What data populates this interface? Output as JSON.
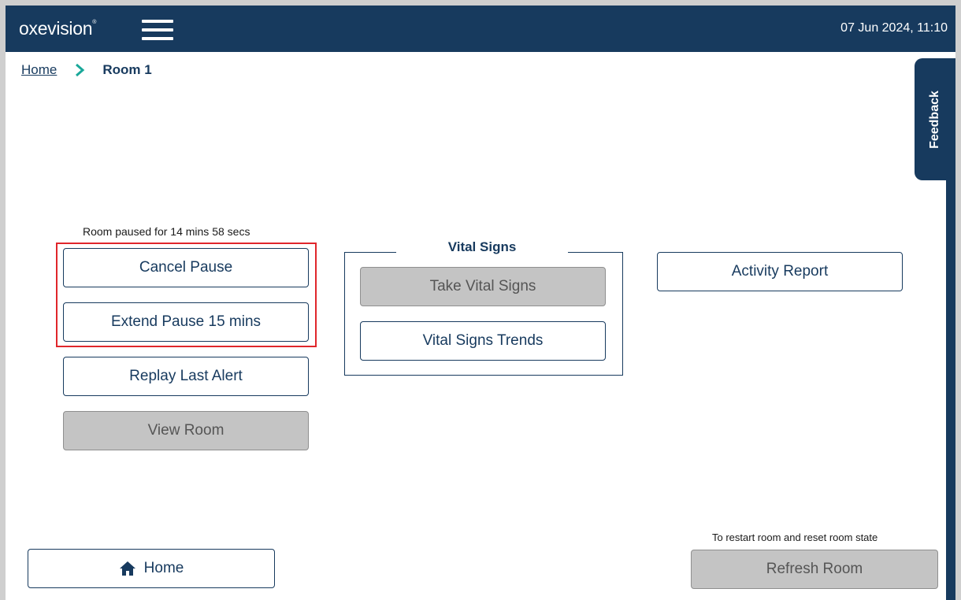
{
  "header": {
    "logo": "oxevision",
    "logo_mark": "®",
    "datetime": "07 Jun 2024, 11:10"
  },
  "breadcrumb": {
    "home": "Home",
    "current": "Room 1"
  },
  "feedback": "Feedback",
  "pause": {
    "status": "Room paused for 14 mins 58 secs",
    "cancel": "Cancel Pause",
    "extend": "Extend Pause 15 mins"
  },
  "actions": {
    "replay": "Replay Last Alert",
    "view_room": "View Room",
    "activity_report": "Activity Report",
    "home": "Home",
    "restart_note": "To restart room and reset room state",
    "refresh_room": "Refresh Room"
  },
  "vital_signs": {
    "legend": "Vital Signs",
    "take": "Take Vital Signs",
    "trends": "Vital Signs Trends"
  },
  "colors": {
    "brand_navy": "#173a5e",
    "highlight_red": "#e0262b",
    "chevron_teal": "#1aa89a",
    "disabled_grey": "#c4c4c4"
  },
  "icons": {
    "menu": "hamburger-icon",
    "chevron": "chevron-right-icon",
    "home": "home-icon"
  }
}
